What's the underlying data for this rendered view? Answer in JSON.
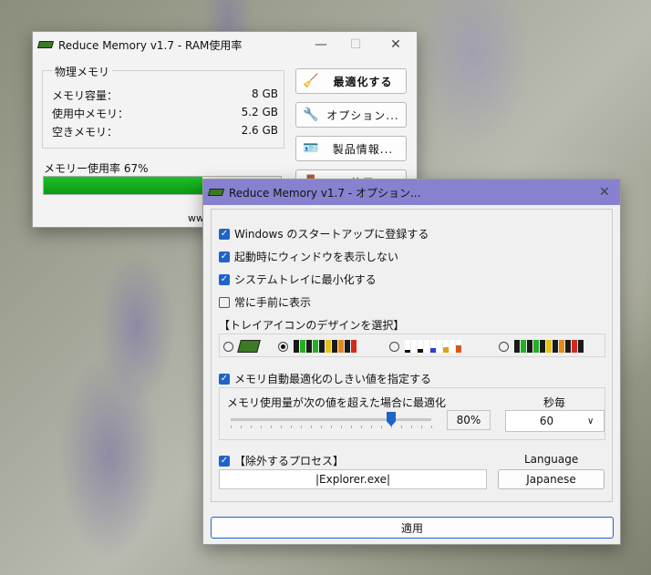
{
  "main_window": {
    "title": "Reduce Memory v1.7 - RAM使用率",
    "physical_group_label": "物理メモリ",
    "rows": [
      {
        "label": "メモリ容量：",
        "value": "8 GB"
      },
      {
        "label": "使用中メモリ：",
        "value": "5.2 GB"
      },
      {
        "label": "空きメモリ：",
        "value": "2.6 GB"
      }
    ],
    "usage_label": "メモリー使用率 67%",
    "usage_percent": 67,
    "buttons": {
      "optimize": "最適化する",
      "options": "オプション...",
      "product_info": "製品情報...",
      "exit": "終了"
    },
    "footer_partial": "ww"
  },
  "options_dialog": {
    "title": "Reduce Memory v1.7 - オプション...",
    "checks": [
      {
        "label": "Windows のスタートアップに登録する",
        "checked": true
      },
      {
        "label": "起動時にウィンドウを表示しない",
        "checked": true
      },
      {
        "label": "システムトレイに最小化する",
        "checked": true
      },
      {
        "label": "常に手前に表示",
        "checked": false
      }
    ],
    "tray_section_label": "【トレイアイコンのデザインを選択】",
    "tray_selected_index": 1,
    "auto_optimize_label": "メモリ自動最適化のしきい値を指定する",
    "auto_optimize_checked": true,
    "threshold_label": "メモリ使用量が次の値を超えた場合に最適化",
    "threshold_value": "80%",
    "threshold_percent": 80,
    "interval_label": "秒毎",
    "interval_value": "60",
    "exclude_label": "【除外するプロセス】",
    "exclude_checked": true,
    "exclude_value": "|Explorer.exe|",
    "language_label": "Language",
    "language_value": "Japanese",
    "apply_label": "適用"
  },
  "colors": {
    "accent": "#1f63c9",
    "dialog_titlebar": "#8781cf",
    "progress": "#15ad20"
  }
}
